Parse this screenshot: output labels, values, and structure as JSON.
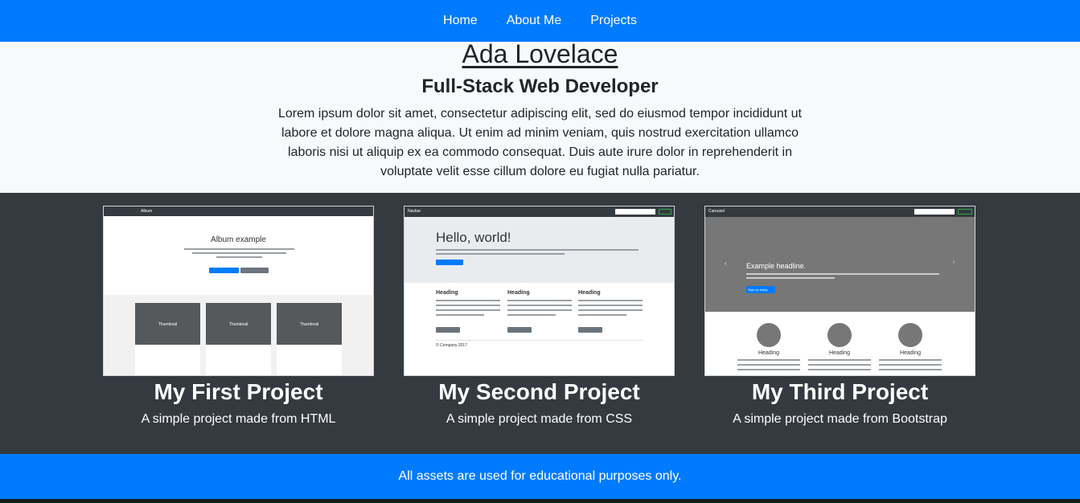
{
  "nav": {
    "items": [
      {
        "label": "Home"
      },
      {
        "label": "About Me"
      },
      {
        "label": "Projects"
      }
    ]
  },
  "hero": {
    "name": "Ada Lovelace",
    "role": "Full-Stack Web Developer",
    "bio": "Lorem ipsum dolor sit amet, consectetur adipiscing elit, sed do eiusmod tempor incididunt ut labore et dolore magna aliqua. Ut enim ad minim veniam, quis nostrud exercitation ullamco laboris nisi ut aliquip ex ea commodo consequat. Duis aute irure dolor in reprehenderit in voluptate velit esse cillum dolore eu fugiat nulla pariatur."
  },
  "projects": [
    {
      "title": "My First Project",
      "description": "A simple project made from HTML",
      "thumb": {
        "brand": "Album",
        "heading": "Album example",
        "tile_label": "Thumbnail"
      }
    },
    {
      "title": "My Second Project",
      "description": "A simple project made from CSS",
      "thumb": {
        "brand": "Navbar",
        "heading": "Hello, world!",
        "col_heading": "Heading",
        "footer": "© Company 2017"
      }
    },
    {
      "title": "My Third Project",
      "description": "A simple project made from Bootstrap",
      "thumb": {
        "brand": "Carousel",
        "headline": "Example headline.",
        "cta": "Sign up today",
        "col_heading": "Heading"
      }
    }
  ],
  "footer": {
    "text": "All assets are used for educational purposes only."
  },
  "colors": {
    "primary": "#007bff",
    "dark": "#343a40",
    "light": "#f8f9fa"
  }
}
